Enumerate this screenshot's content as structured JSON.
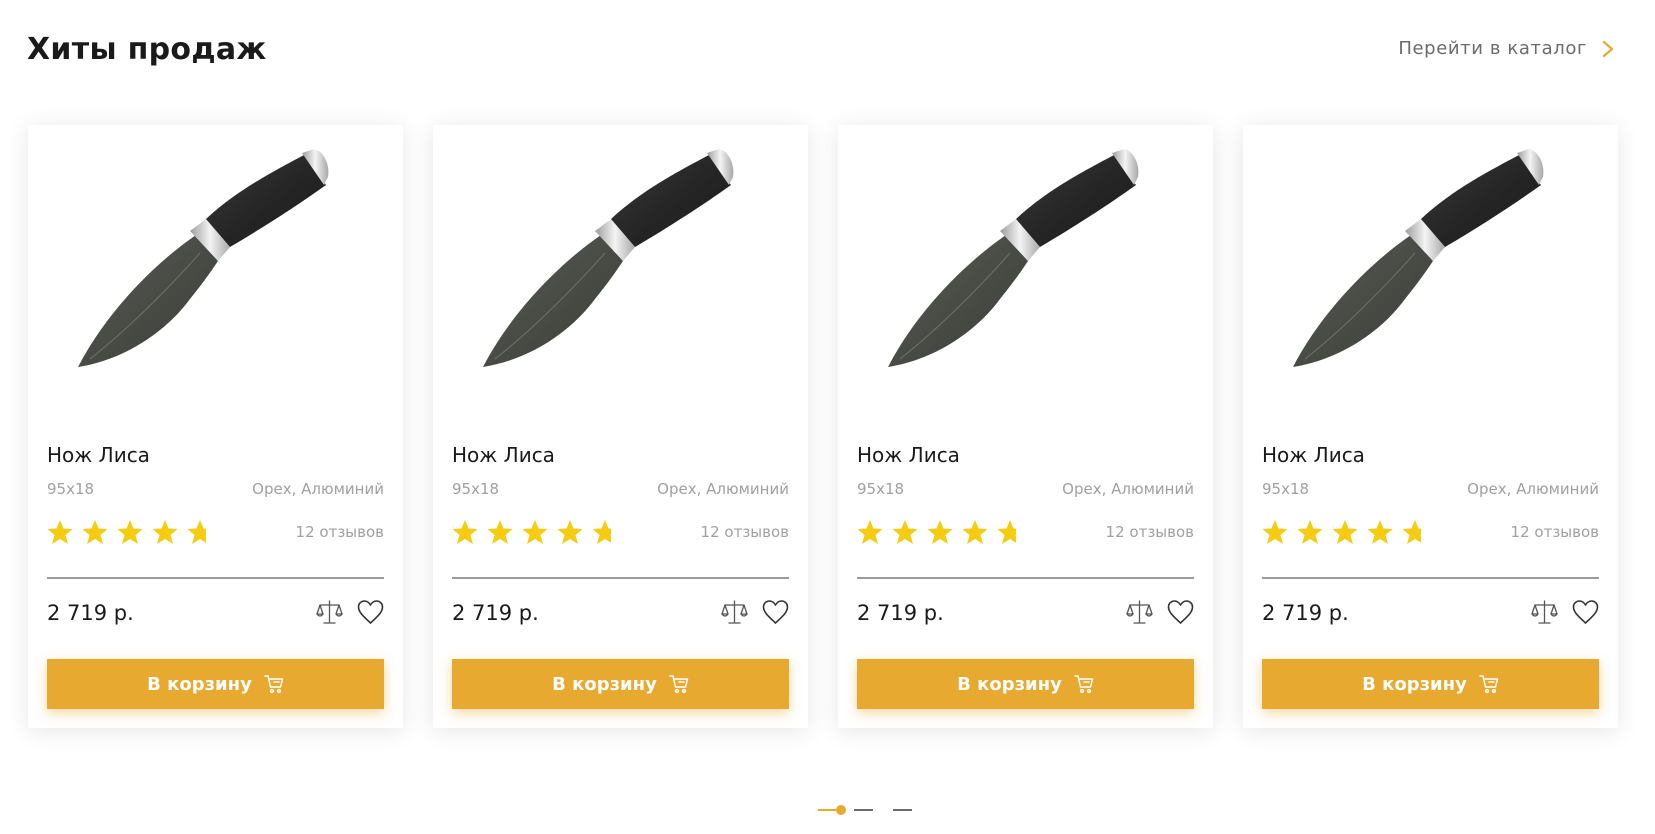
{
  "header": {
    "title": "Хиты продаж",
    "catalog_link": "Перейти в каталог"
  },
  "colors": {
    "accent": "#e8a931",
    "star_filled": "#f5cc12",
    "star_empty": "#1a1a1a"
  },
  "products": [
    {
      "name": "Нож Лиса",
      "steel": "95х18",
      "material": "Орех, Алюминий",
      "rating": 4.5,
      "reviews": "12 отзывов",
      "price": "2 719 р.",
      "button": "В корзину"
    },
    {
      "name": "Нож Лиса",
      "steel": "95х18",
      "material": "Орех, Алюминий",
      "rating": 4.5,
      "reviews": "12 отзывов",
      "price": "2 719 р.",
      "button": "В корзину"
    },
    {
      "name": "Нож Лиса",
      "steel": "95х18",
      "material": "Орех, Алюминий",
      "rating": 4.5,
      "reviews": "12 отзывов",
      "price": "2 719 р.",
      "button": "В корзину"
    },
    {
      "name": "Нож Лиса",
      "steel": "95х18",
      "material": "Орех, Алюминий",
      "rating": 4.5,
      "reviews": "12 отзывов",
      "price": "2 719 р.",
      "button": "В корзину"
    }
  ],
  "icons": {
    "compare": "scales-icon",
    "favorite": "heart-icon",
    "cart": "cart-icon",
    "catalog_arrow": "chevron-right-icon"
  },
  "pagination": {
    "pages": 3,
    "active": 1
  }
}
